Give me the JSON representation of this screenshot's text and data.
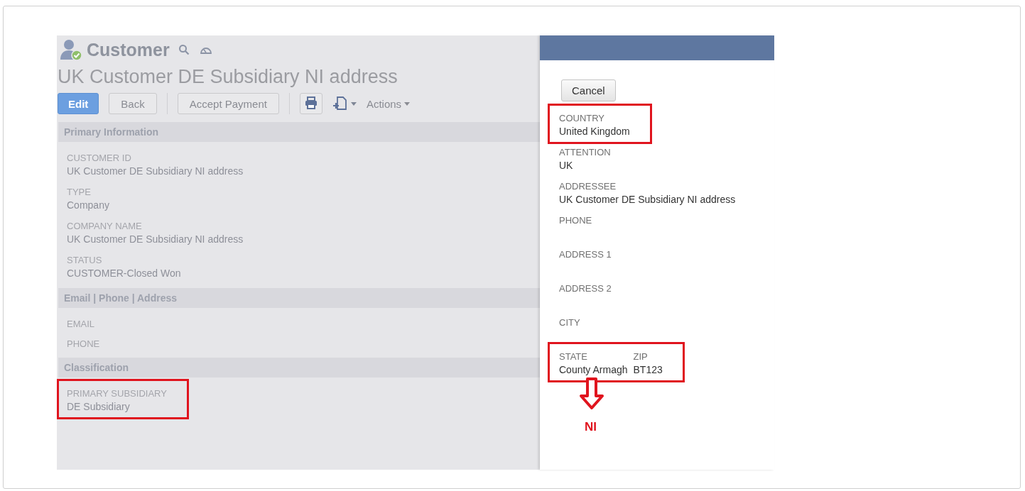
{
  "record": {
    "type_title": "Customer",
    "name": "UK Customer DE Subsidiary NI address",
    "toolbar": [
      {
        "kind": "primary",
        "label": "Edit"
      },
      {
        "kind": "button",
        "label": "Back"
      },
      {
        "kind": "divider"
      },
      {
        "kind": "button",
        "label": "Accept Payment"
      },
      {
        "kind": "divider"
      },
      {
        "kind": "print"
      },
      {
        "kind": "new-menu"
      },
      {
        "kind": "menu",
        "label": "Actions"
      }
    ],
    "sections": [
      {
        "title": "Primary Information",
        "fields": [
          {
            "label": "CUSTOMER ID",
            "value": "UK Customer DE Subsidiary NI address",
            "highlighted": false
          },
          {
            "label": "TYPE",
            "value": "Company",
            "highlighted": false
          },
          {
            "label": "COMPANY NAME",
            "value": "UK Customer DE Subsidiary NI address",
            "highlighted": false
          },
          {
            "label": "STATUS",
            "value": "CUSTOMER-Closed Won",
            "highlighted": false
          }
        ]
      },
      {
        "title": "Email | Phone | Address",
        "fields": [
          {
            "label": "EMAIL",
            "highlighted": false
          },
          {
            "label": "PHONE",
            "highlighted": false
          }
        ]
      },
      {
        "title": "Classification",
        "fields": [
          {
            "label": "PRIMARY SUBSIDIARY",
            "value": "DE Subsidiary",
            "highlighted": true
          }
        ]
      }
    ]
  },
  "popup": {
    "cancel": "Cancel",
    "fields": [
      {
        "kind": "single",
        "label": "COUNTRY",
        "value": "United Kingdom",
        "highlighted": true
      },
      {
        "kind": "single",
        "label": "ATTENTION",
        "value": "UK",
        "highlighted": false
      },
      {
        "kind": "single",
        "label": "ADDRESSEE",
        "value": "UK Customer DE Subsidiary NI address",
        "highlighted": false
      },
      {
        "kind": "single",
        "label": "PHONE",
        "highlighted": false
      },
      {
        "kind": "single",
        "label": "ADDRESS 1",
        "highlighted": false
      },
      {
        "kind": "single",
        "label": "ADDRESS 2",
        "highlighted": false
      },
      {
        "kind": "single",
        "label": "CITY",
        "highlighted": false
      },
      {
        "kind": "pair",
        "parts": [
          {
            "label": "STATE",
            "value": "County Armagh"
          },
          {
            "label": "ZIP",
            "value": "BT123"
          }
        ],
        "highlighted": true
      }
    ],
    "annotation": "NI"
  }
}
